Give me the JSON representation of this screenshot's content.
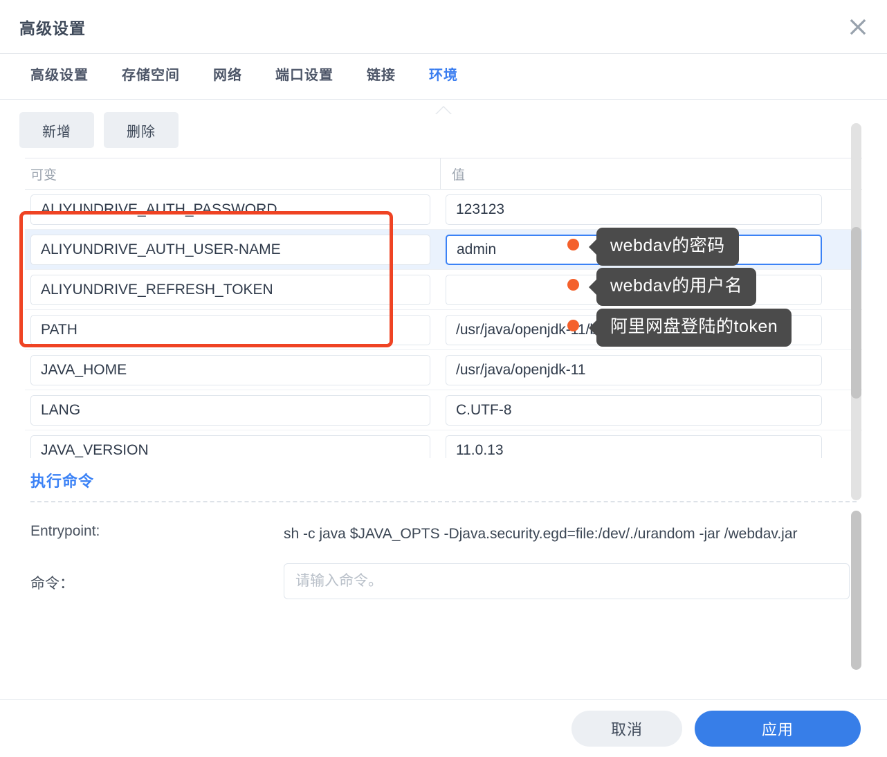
{
  "window": {
    "title": "高级设置",
    "close_icon": "close-icon"
  },
  "tabs": [
    {
      "label": "高级设置",
      "active": false
    },
    {
      "label": "存储空间",
      "active": false
    },
    {
      "label": "网络",
      "active": false
    },
    {
      "label": "端口设置",
      "active": false
    },
    {
      "label": "链接",
      "active": false
    },
    {
      "label": "环境",
      "active": true
    }
  ],
  "toolbar": {
    "add_label": "新增",
    "delete_label": "删除"
  },
  "table": {
    "headers": {
      "variable": "可变",
      "value": "值"
    },
    "rows": [
      {
        "variable": "ALIYUNDRIVE_AUTH_PASSWORD",
        "value": "123123",
        "selected": false
      },
      {
        "variable": "ALIYUNDRIVE_AUTH_USER-NAME",
        "value": "admin",
        "selected": true
      },
      {
        "variable": "ALIYUNDRIVE_REFRESH_TOKEN",
        "value": "",
        "selected": false
      },
      {
        "variable": "PATH",
        "value": "/usr/java/openjdk-11/bin:/usr/local...",
        "selected": false
      },
      {
        "variable": "JAVA_HOME",
        "value": "/usr/java/openjdk-11",
        "selected": false
      },
      {
        "variable": "LANG",
        "value": "C.UTF-8",
        "selected": false
      },
      {
        "variable": "JAVA_VERSION",
        "value": "11.0.13",
        "selected": false
      }
    ]
  },
  "annotations": {
    "highlight_color": "#ef4323",
    "dot_color": "#f4602b",
    "tooltip_bg": "#4b4b4b",
    "tooltips": [
      {
        "text": "webdav的密码"
      },
      {
        "text": "webdav的用户名"
      },
      {
        "text": "阿里网盘登陆的token"
      }
    ]
  },
  "command": {
    "section_title": "执行命令",
    "entrypoint_label": "Entrypoint:",
    "entrypoint_value": "sh -c java $JAVA_OPTS -Djava.security.egd=file:/dev/./urandom -jar /webdav.jar",
    "command_label": "命令：",
    "command_value": "",
    "command_placeholder": "请输入命令。"
  },
  "footer": {
    "cancel_label": "取消",
    "apply_label": "应用",
    "apply_color": "#377ee8"
  }
}
